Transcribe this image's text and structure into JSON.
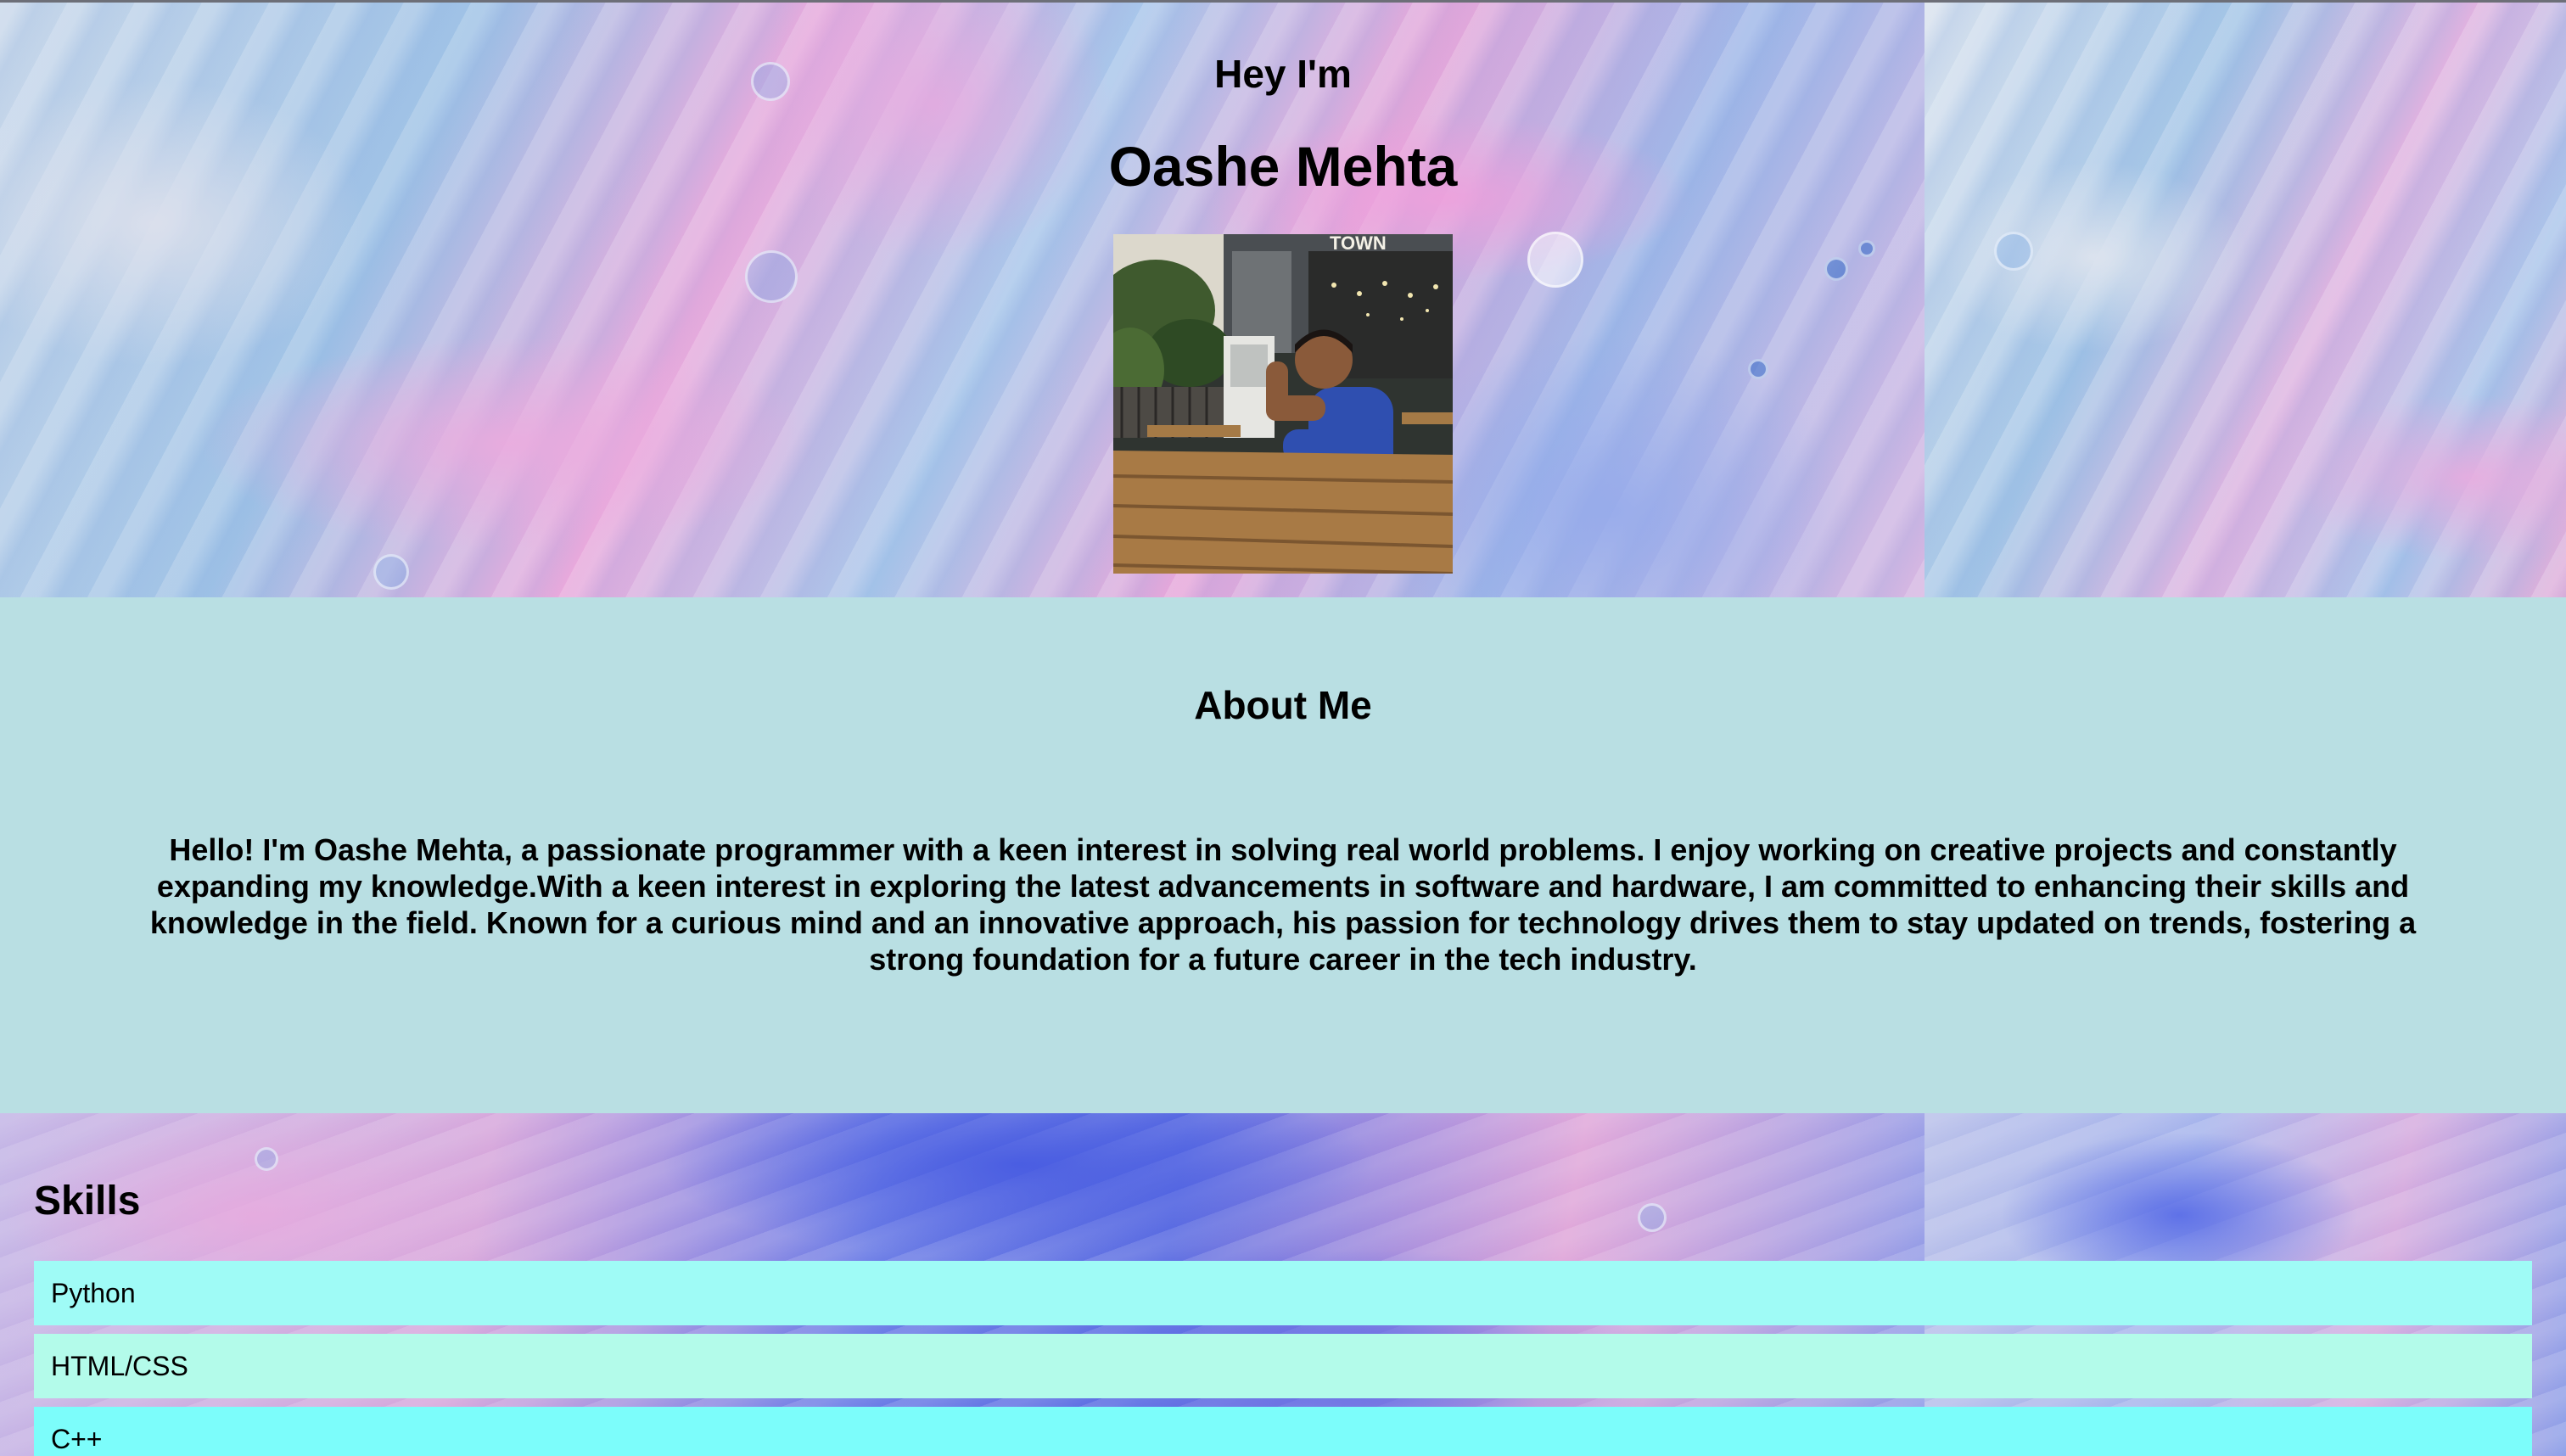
{
  "hero": {
    "greeting": "Hey I'm",
    "name": "Oashe Mehta",
    "photo_sign_text": "TOWN"
  },
  "about": {
    "heading": "About Me",
    "text": "Hello! I'm Oashe Mehta, a passionate programmer with a keen interest in solving real world problems. I enjoy working on creative projects and constantly expanding my knowledge.With a keen interest in exploring the latest advancements in software and hardware, I am committed to enhancing their skills and knowledge in the field. Known for a curious mind and an innovative approach, his passion for technology drives them to stay updated on trends, fostering a strong foundation for a future career in the tech industry."
  },
  "skills": {
    "heading": "Skills",
    "items": [
      {
        "label": "Python",
        "color": "#9ffbf6"
      },
      {
        "label": "HTML/CSS",
        "color": "#b3fbea"
      },
      {
        "label": "C++",
        "color": "#7cfdfb"
      }
    ]
  },
  "colors": {
    "about_background": "#b9dfe3",
    "text": "#000000"
  }
}
